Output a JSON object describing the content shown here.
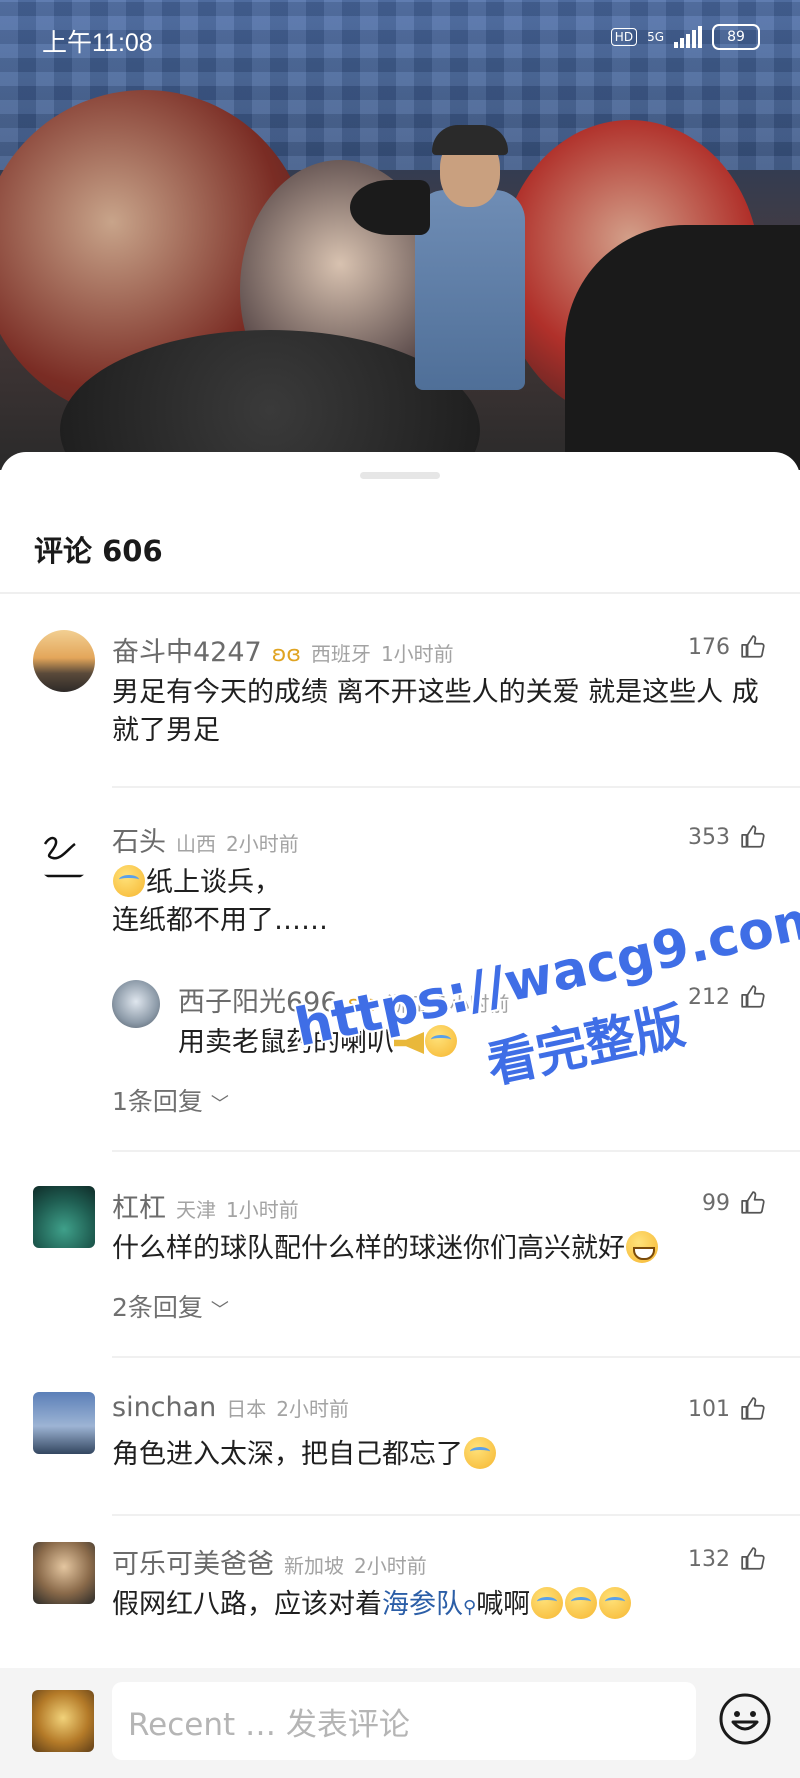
{
  "status_bar": {
    "time": "上午11:08",
    "network": "5G",
    "hd": "HD",
    "battery": "89"
  },
  "comments_panel": {
    "title": "评论 606"
  },
  "comments": [
    {
      "name": "奋斗中4247",
      "has_badge": true,
      "location": "西班牙",
      "time": "1小时前",
      "likes": "176",
      "text": "男足有今天的成绩 离不开这些人的关爱 就是这些人 成就了男足"
    },
    {
      "name": "石头",
      "has_badge": false,
      "location": "山西",
      "time": "2小时前",
      "likes": "353",
      "text_line1": "纸上谈兵，",
      "text_line2": "连纸都不用了……",
      "reply": {
        "name": "西子阳光696",
        "location": "浙江",
        "time": "1小时前",
        "likes": "212",
        "text": "用卖老鼠药的喇叭"
      },
      "replies_label": "1条回复"
    },
    {
      "name": "杠杠",
      "has_badge": false,
      "location": "天津",
      "time": "1小时前",
      "likes": "99",
      "text": "什么样的球队配什么样的球迷你们高兴就好",
      "replies_label": "2条回复"
    },
    {
      "name": "sinchan",
      "has_badge": false,
      "location": "日本",
      "time": "2小时前",
      "likes": "101",
      "text": "角色进入太深，把自己都忘了"
    },
    {
      "name": "可乐可美爸爸",
      "has_badge": false,
      "location": "新加坡",
      "time": "2小时前",
      "likes": "132",
      "text_before": "假网红八路，应该对着",
      "text_link": "海参队",
      "text_after": "喊啊"
    }
  ],
  "watermark": {
    "line1": "https://wacg9.com",
    "line2": "看完整版"
  },
  "input_bar": {
    "placeholder": "Recent … 发表评论"
  },
  "icons": {
    "badge": "flame-badge-icon",
    "like": "thumbs-up-icon",
    "chevron": "chevron-down-icon",
    "emoji": "smiley-icon"
  },
  "colors": {
    "link": "#2b5ea7",
    "watermark": "#3f6ee6",
    "badge": "#e0a422"
  }
}
